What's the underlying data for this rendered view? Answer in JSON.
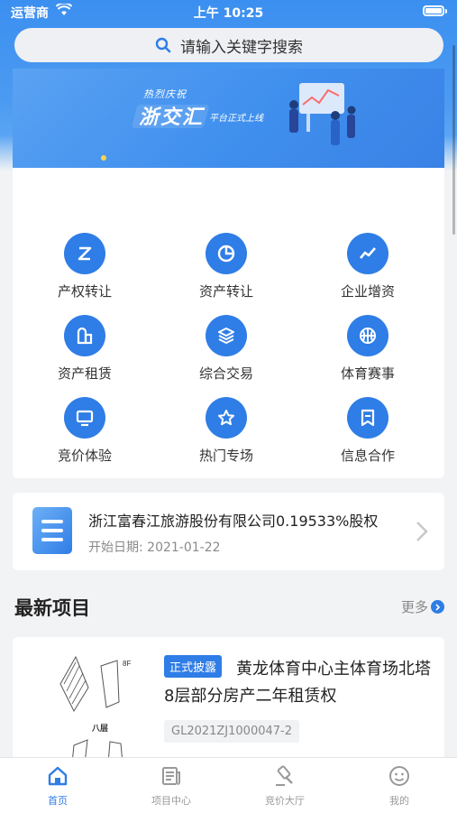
{
  "status": {
    "carrier": "运营商",
    "time": "上午 10:25"
  },
  "search": {
    "placeholder": "请输入关键字搜索"
  },
  "banner": {
    "small": "热烈庆祝",
    "big": "浙交汇",
    "tag": "平台正式上线"
  },
  "grid": [
    {
      "label": "产权转让",
      "icon": "equity-transfer-icon"
    },
    {
      "label": "资产转让",
      "icon": "pie-chart-icon"
    },
    {
      "label": "企业增资",
      "icon": "trend-line-icon"
    },
    {
      "label": "资产租赁",
      "icon": "building-icon"
    },
    {
      "label": "综合交易",
      "icon": "layers-icon"
    },
    {
      "label": "体育赛事",
      "icon": "basketball-icon"
    },
    {
      "label": "竞价体验",
      "icon": "monitor-icon"
    },
    {
      "label": "热门专场",
      "icon": "star-icon"
    },
    {
      "label": "信息合作",
      "icon": "bookmark-icon"
    }
  ],
  "notice": {
    "title": "浙江富春江旅游股份有限公司0.19533%股权",
    "date_label": "开始日期:",
    "date": "2021-01-22"
  },
  "latest": {
    "title": "最新项目",
    "more": "更多"
  },
  "project": {
    "badge": "正式披露",
    "title": "黄龙体育中心主体育场北塔8层部分房产二年租赁权",
    "code": "GL2021ZJ1000047-2",
    "thumb_label": "八层"
  },
  "tabs": [
    {
      "label": "首页",
      "icon": "home-icon",
      "active": true
    },
    {
      "label": "项目中心",
      "icon": "newspaper-icon",
      "active": false
    },
    {
      "label": "竞价大厅",
      "icon": "gavel-icon",
      "active": false
    },
    {
      "label": "我的",
      "icon": "smiley-icon",
      "active": false
    }
  ],
  "colors": {
    "primary": "#2f7de6",
    "background": "#f2f3f5"
  }
}
